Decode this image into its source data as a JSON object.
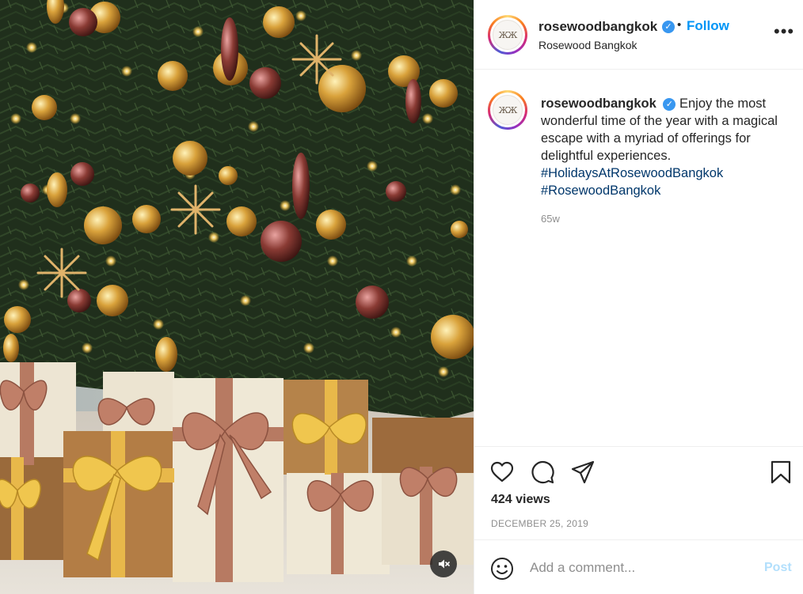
{
  "media": {
    "description_icon": "mute-icon"
  },
  "post": {
    "username": "rosewoodbangkok",
    "verified": true,
    "follow_label": "Follow",
    "separator": "•",
    "location": "Rosewood Bangkok",
    "avatar_text": "ЖЖ",
    "more_label": "•••"
  },
  "caption": {
    "username": "rosewoodbangkok",
    "text": "Enjoy the most wonderful time of the year with a magical escape with a myriad of offerings for delightful experiences.",
    "hashtags": [
      "#HolidaysAtRosewoodBangkok",
      "#RosewoodBangkok"
    ],
    "time_ago": "65w"
  },
  "actions": {
    "icons": [
      "heart-icon",
      "comment-icon",
      "share-icon",
      "bookmark-icon"
    ],
    "views": "424 views",
    "date": "DECEMBER 25, 2019"
  },
  "comment": {
    "placeholder": "Add a comment...",
    "post_label": "Post"
  },
  "colors": {
    "follow": "#0095f6",
    "hashtag": "#00376b",
    "post_disabled": "#b2dffc",
    "muted_text": "#8e8e8e"
  }
}
